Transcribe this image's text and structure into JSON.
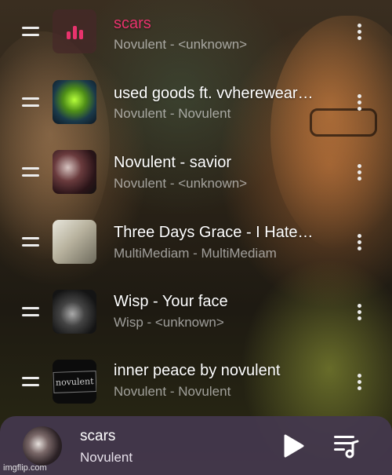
{
  "queue": [
    {
      "title": "scars",
      "subtitle": "Novulent - <unknown>",
      "active": true
    },
    {
      "title": "used goods ft. vvherewear…",
      "subtitle": "Novulent - Novulent"
    },
    {
      "title": "Novulent - savior",
      "subtitle": "Novulent - <unknown>"
    },
    {
      "title": "Three Days Grace - I Hate…",
      "subtitle": "MultiMediam - MultiMediam"
    },
    {
      "title": "Wisp - Your face",
      "subtitle": "Wisp - <unknown>"
    },
    {
      "title": "inner peace by novulent",
      "subtitle": "Novulent - Novulent",
      "art_text": "novulent"
    }
  ],
  "now_playing": {
    "title": "scars",
    "artist": "Novulent"
  },
  "watermark": "imgflip.com",
  "colors": {
    "accent": "#e8336d",
    "player_bg": "#44384e"
  },
  "icons": {
    "drag": "drag-handle-icon",
    "more": "more-vert-icon",
    "play": "play-icon",
    "queue": "queue-music-icon"
  }
}
